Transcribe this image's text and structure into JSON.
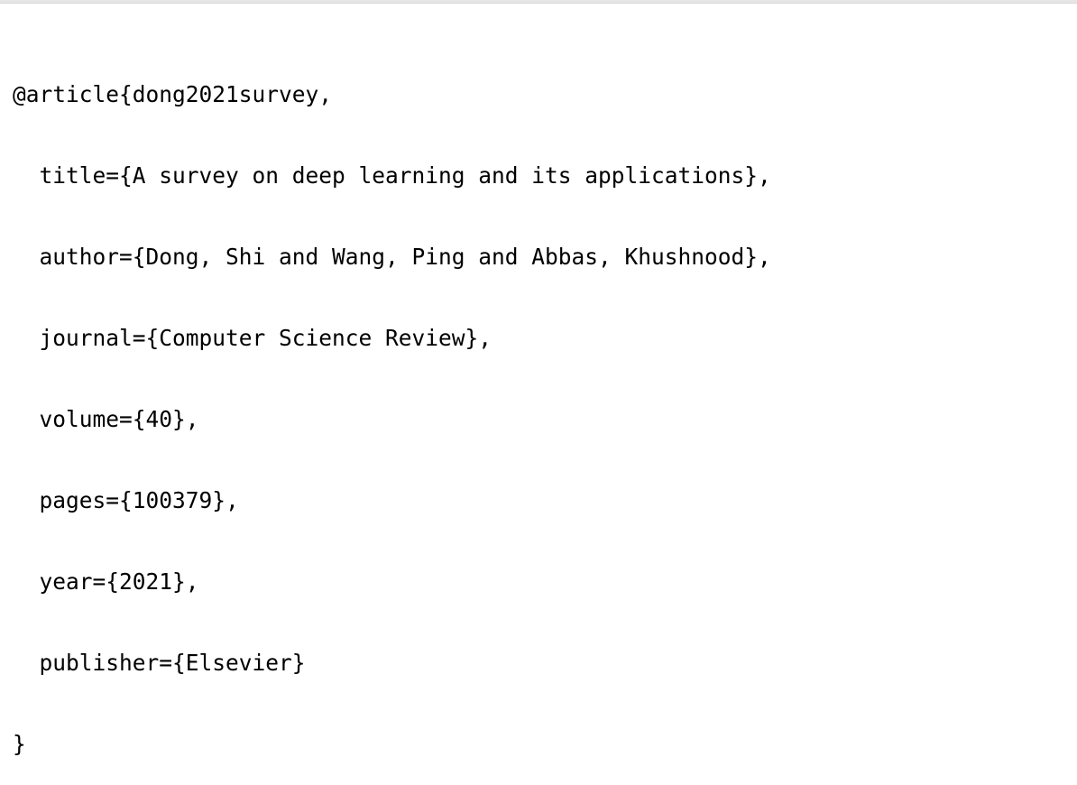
{
  "bibtex": {
    "lines": [
      "@article{dong2021survey,",
      "  title={A survey on deep learning and its applications},",
      "  author={Dong, Shi and Wang, Ping and Abbas, Khushnood},",
      "  journal={Computer Science Review},",
      "  volume={40},",
      "  pages={100379},",
      "  year={2021},",
      "  publisher={Elsevier}",
      "}"
    ]
  }
}
